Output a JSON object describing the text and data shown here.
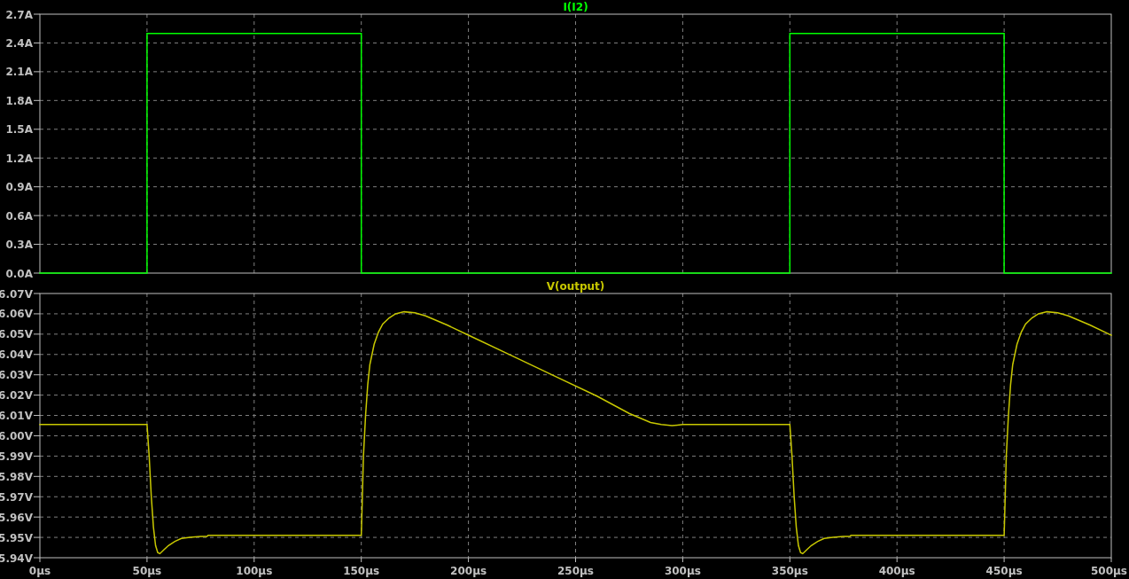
{
  "plots": [
    {
      "chart_data": {
        "type": "line",
        "grid": true,
        "xlim": [
          0,
          500
        ],
        "ylim": [
          0,
          2.7
        ],
        "x": [
          0,
          50,
          50,
          150,
          150,
          350,
          350,
          450,
          450,
          500
        ],
        "series": [
          {
            "name": "I(I2)",
            "color": "#00ff00",
            "values": [
              0,
              0,
              2.5,
              2.5,
              0,
              0,
              2.5,
              2.5,
              0,
              0
            ]
          }
        ],
        "yticks": [
          {
            "value": 0,
            "label": "0.0A"
          },
          {
            "value": 0.3,
            "label": "0.3A"
          },
          {
            "value": 0.6,
            "label": "0.6A"
          },
          {
            "value": 0.9,
            "label": "0.9A"
          },
          {
            "value": 1.2,
            "label": "1.2A"
          },
          {
            "value": 1.5,
            "label": "1.5A"
          },
          {
            "value": 1.8,
            "label": "1.8A"
          },
          {
            "value": 2.1,
            "label": "2.1A"
          },
          {
            "value": 2.4,
            "label": "2.4A"
          },
          {
            "value": 2.7,
            "label": "2.7A"
          }
        ]
      }
    },
    {
      "chart_data": {
        "type": "line",
        "grid": true,
        "xlim": [
          0,
          500
        ],
        "ylim": [
          5.94,
          6.07
        ],
        "x": [
          0,
          50,
          51,
          52,
          53,
          54,
          55,
          56,
          58,
          60,
          63,
          66,
          70,
          75,
          78,
          78.5,
          150,
          150.5,
          151,
          152,
          153,
          154,
          156,
          158,
          160,
          163,
          166,
          170,
          175,
          180,
          190,
          200,
          220,
          240,
          260,
          275,
          285,
          290,
          295,
          300,
          350,
          351,
          352,
          353,
          354,
          355,
          356,
          358,
          360,
          363,
          366,
          370,
          375,
          378,
          378.5,
          450,
          450.5,
          451,
          452,
          453,
          454,
          456,
          458,
          460,
          463,
          466,
          470,
          475,
          480,
          490,
          500
        ],
        "series": [
          {
            "name": "V(output)",
            "color": "#c8c800",
            "values": [
              6.0055,
              6.0055,
              5.99,
              5.97,
              5.955,
              5.946,
              5.9425,
              5.942,
              5.944,
              5.946,
              5.948,
              5.9495,
              5.95,
              5.9505,
              5.9505,
              5.951,
              5.951,
              5.97,
              5.99,
              6.01,
              6.025,
              6.035,
              6.045,
              6.051,
              6.055,
              6.058,
              6.06,
              6.061,
              6.0605,
              6.059,
              6.0545,
              6.0495,
              6.0395,
              6.0295,
              6.0195,
              6.011,
              6.0065,
              6.0055,
              6.005,
              6.0055,
              6.0055,
              5.99,
              5.97,
              5.955,
              5.946,
              5.9425,
              5.942,
              5.944,
              5.946,
              5.948,
              5.9495,
              5.95,
              5.9505,
              5.9505,
              5.951,
              5.951,
              5.97,
              5.99,
              6.01,
              6.025,
              6.035,
              6.045,
              6.051,
              6.055,
              6.058,
              6.06,
              6.061,
              6.0605,
              6.059,
              6.0545,
              6.0495
            ]
          }
        ],
        "xticks": [
          {
            "value": 0,
            "label": "0µs"
          },
          {
            "value": 50,
            "label": "50µs"
          },
          {
            "value": 100,
            "label": "100µs"
          },
          {
            "value": 150,
            "label": "150µs"
          },
          {
            "value": 200,
            "label": "200µs"
          },
          {
            "value": 250,
            "label": "250µs"
          },
          {
            "value": 300,
            "label": "300µs"
          },
          {
            "value": 350,
            "label": "350µs"
          },
          {
            "value": 400,
            "label": "400µs"
          },
          {
            "value": 450,
            "label": "450µs"
          },
          {
            "value": 500,
            "label": "500µs"
          }
        ],
        "yticks": [
          {
            "value": 5.94,
            "label": "5.94V"
          },
          {
            "value": 5.95,
            "label": "5.95V"
          },
          {
            "value": 5.96,
            "label": "5.96V"
          },
          {
            "value": 5.97,
            "label": "5.97V"
          },
          {
            "value": 5.98,
            "label": "5.98V"
          },
          {
            "value": 5.99,
            "label": "5.99V"
          },
          {
            "value": 6.0,
            "label": "6.00V"
          },
          {
            "value": 6.01,
            "label": "6.01V"
          },
          {
            "value": 6.02,
            "label": "6.02V"
          },
          {
            "value": 6.03,
            "label": "6.03V"
          },
          {
            "value": 6.04,
            "label": "6.04V"
          },
          {
            "value": 6.05,
            "label": "6.05V"
          },
          {
            "value": 6.06,
            "label": "6.06V"
          },
          {
            "value": 6.07,
            "label": "6.07V"
          }
        ]
      }
    }
  ]
}
